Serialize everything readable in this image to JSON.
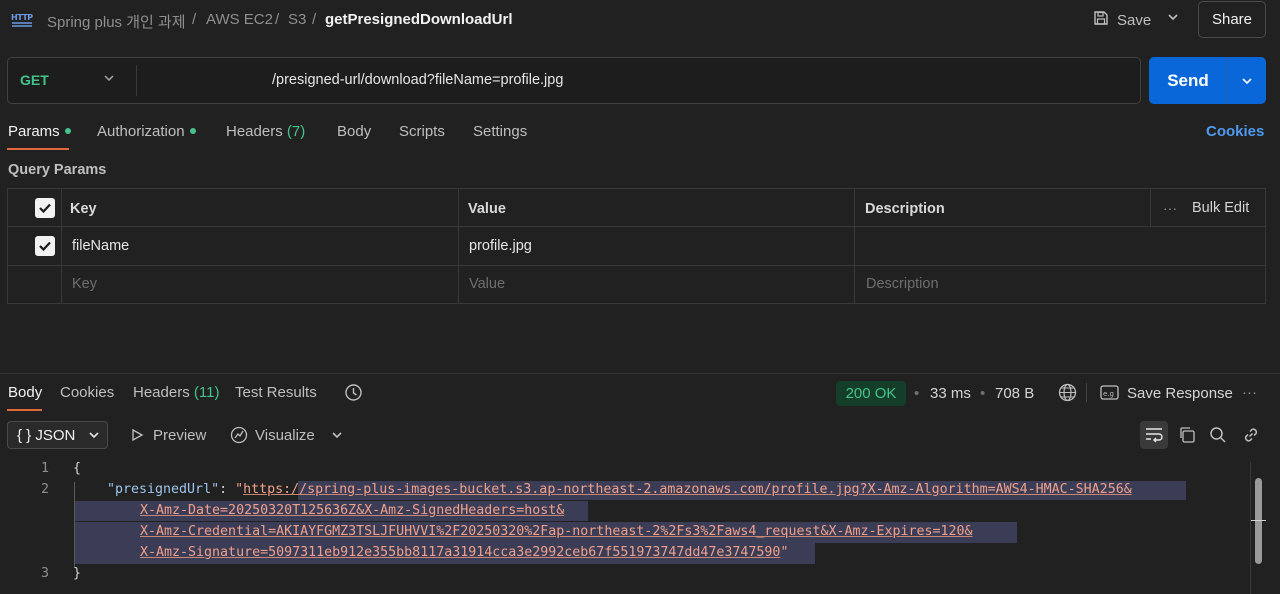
{
  "header": {
    "http_icon_label": "HTTP",
    "breadcrumb": [
      "Spring plus 개인 과제",
      "AWS EC2",
      "S3"
    ],
    "separator": "/",
    "current": "getPresignedDownloadUrl",
    "save_label": "Save",
    "share_label": "Share"
  },
  "request": {
    "method": "GET",
    "url": "/presigned-url/download?fileName=profile.jpg",
    "send_label": "Send"
  },
  "request_tabs": {
    "params": "Params",
    "authorization": "Authorization",
    "headers": "Headers",
    "headers_count": "(7)",
    "body": "Body",
    "scripts": "Scripts",
    "settings": "Settings",
    "cookies": "Cookies"
  },
  "query_params": {
    "title": "Query Params",
    "columns": {
      "key": "Key",
      "value": "Value",
      "description": "Description",
      "bulk_edit": "Bulk Edit"
    },
    "rows": [
      {
        "checked": true,
        "key": "fileName",
        "value": "profile.jpg",
        "description": ""
      }
    ],
    "placeholder": {
      "key": "Key",
      "value": "Value",
      "description": "Description"
    }
  },
  "response_tabs": {
    "body": "Body",
    "cookies": "Cookies",
    "headers": "Headers",
    "headers_count": "(11)",
    "test_results": "Test Results"
  },
  "response_meta": {
    "status": "200 OK",
    "time": "33 ms",
    "size": "708 B",
    "save_response": "Save Response"
  },
  "viewer": {
    "format": "JSON",
    "preview": "Preview",
    "visualize": "Visualize"
  },
  "code": {
    "line_numbers": [
      "1",
      "2",
      "3"
    ],
    "open_brace": "{",
    "close_brace": "}",
    "key": "\"presignedUrl\"",
    "colon": ": ",
    "quote_open": "\"",
    "url_lines": [
      "https://spring-plus-images-bucket.s3.ap-northeast-2.amazonaws.com/profile.jpg?X-Amz-Algorithm=AWS4-HMAC-SHA256&",
      "X-Amz-Date=20250320T125636Z&X-Amz-SignedHeaders=host&",
      "X-Amz-Credential=AKIAYFGMZ3TSLJFUHVVI%2F20250320%2Fap-northeast-2%2Fs3%2Faws4_request&X-Amz-Expires=120&",
      "X-Amz-Signature=5097311eb912e355bb8117a31914cca3e2992ceb67f551973747dd47e3747590"
    ],
    "quote_close": "\""
  },
  "colors": {
    "accent_send": "#0a67d9",
    "method_get": "#43c48a",
    "tab_underline": "#e06a3b",
    "link": "#4f9bf0"
  }
}
